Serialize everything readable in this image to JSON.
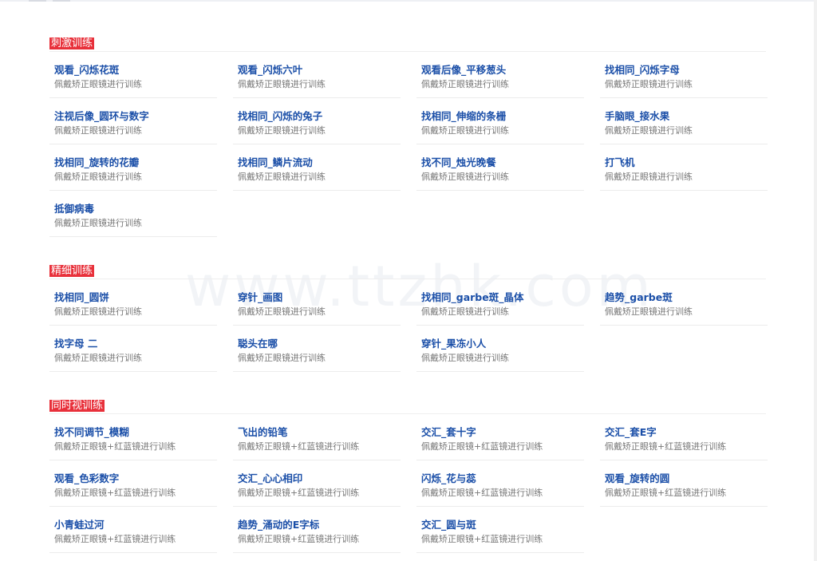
{
  "watermark": "www.ttzhk.com",
  "sections": [
    {
      "title": "刺激训练",
      "items": [
        {
          "title": "观看_闪烁花斑",
          "desc": "佩戴矫正眼镜进行训练"
        },
        {
          "title": "观看_闪烁六叶",
          "desc": "佩戴矫正眼镜进行训练"
        },
        {
          "title": "观看后像_平移葱头",
          "desc": "佩戴矫正眼镜进行训练"
        },
        {
          "title": "找相同_闪烁字母",
          "desc": "佩戴矫正眼镜进行训练"
        },
        {
          "title": "注视后像_圆环与数字",
          "desc": "佩戴矫正眼镜进行训练"
        },
        {
          "title": "找相同_闪烁的兔子",
          "desc": "佩戴矫正眼镜进行训练"
        },
        {
          "title": "找相同_伸缩的条栅",
          "desc": "佩戴矫正眼镜进行训练"
        },
        {
          "title": "手脑眼_接水果",
          "desc": "佩戴矫正眼镜进行训练"
        },
        {
          "title": "找相同_旋转的花瓣",
          "desc": "佩戴矫正眼镜进行训练"
        },
        {
          "title": "找相同_鳞片流动",
          "desc": "佩戴矫正眼镜进行训练"
        },
        {
          "title": "找不同_烛光晚餐",
          "desc": "佩戴矫正眼镜进行训练"
        },
        {
          "title": "打飞机",
          "desc": "佩戴矫正眼镜进行训练"
        },
        {
          "title": "抵御病毒",
          "desc": "佩戴矫正眼镜进行训练"
        }
      ]
    },
    {
      "title": "精细训练",
      "items": [
        {
          "title": "找相同_圆饼",
          "desc": "佩戴矫正眼镜进行训练"
        },
        {
          "title": "穿针_画图",
          "desc": "佩戴矫正眼镜进行训练"
        },
        {
          "title": "找相同_garbe斑_晶体",
          "desc": "佩戴矫正眼镜进行训练"
        },
        {
          "title": "趋势_garbe斑",
          "desc": "佩戴矫正眼镜进行训练"
        },
        {
          "title": "找字母 二",
          "desc": "佩戴矫正眼镜进行训练"
        },
        {
          "title": "聪头在哪",
          "desc": "佩戴矫正眼镜进行训练"
        },
        {
          "title": "穿针_果冻小人",
          "desc": "佩戴矫正眼镜进行训练"
        }
      ]
    },
    {
      "title": "同时视训练",
      "items": [
        {
          "title": "找不同调节_模糊",
          "desc": "佩戴矫正眼镜+红蓝镜进行训练"
        },
        {
          "title": "飞出的铅笔",
          "desc": "佩戴矫正眼镜+红蓝镜进行训练"
        },
        {
          "title": "交汇_套十字",
          "desc": "佩戴矫正眼镜+红蓝镜进行训练"
        },
        {
          "title": "交汇_套E字",
          "desc": "佩戴矫正眼镜+红蓝镜进行训练"
        },
        {
          "title": "观看_色彩数字",
          "desc": "佩戴矫正眼镜+红蓝镜进行训练"
        },
        {
          "title": "交汇_心心相印",
          "desc": "佩戴矫正眼镜+红蓝镜进行训练"
        },
        {
          "title": "闪烁_花与蕊",
          "desc": "佩戴矫正眼镜+红蓝镜进行训练"
        },
        {
          "title": "观看_旋转的圆",
          "desc": "佩戴矫正眼镜+红蓝镜进行训练"
        },
        {
          "title": "小青蛙过河",
          "desc": "佩戴矫正眼镜+红蓝镜进行训练"
        },
        {
          "title": "趋势_涌动的E字标",
          "desc": "佩戴矫正眼镜+红蓝镜进行训练"
        },
        {
          "title": "交汇_圆与斑",
          "desc": "佩戴矫正眼镜+红蓝镜进行训练"
        }
      ]
    }
  ]
}
